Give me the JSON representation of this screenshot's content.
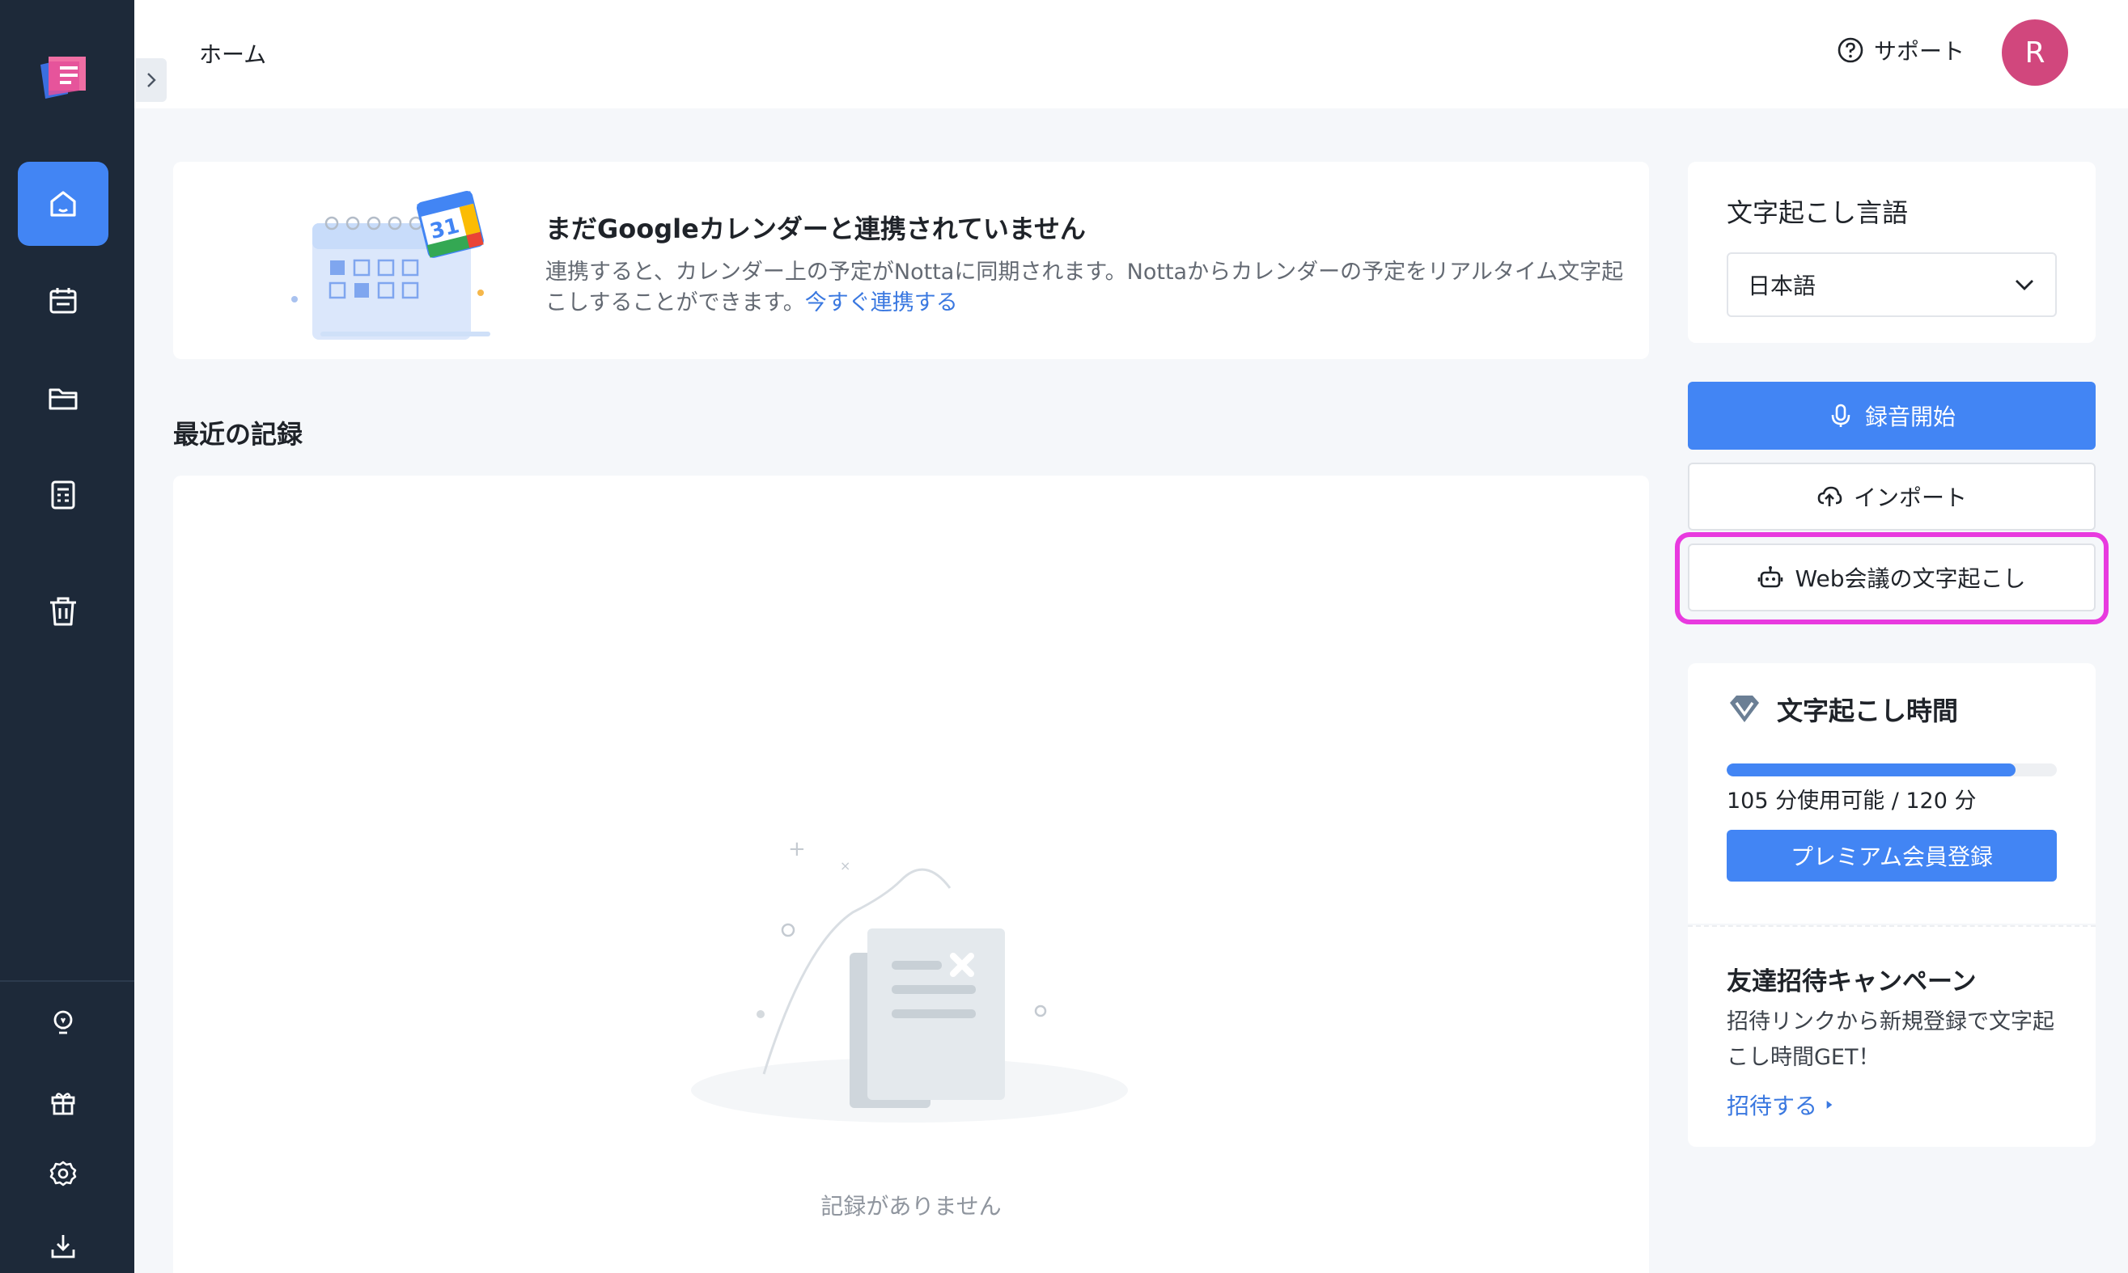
{
  "header": {
    "breadcrumb": "ホーム",
    "support_label": "サポート",
    "avatar_initial": "R"
  },
  "sidebar": {
    "items": [
      {
        "icon": "home-icon",
        "active": true
      },
      {
        "icon": "calendar-icon",
        "active": false
      },
      {
        "icon": "folder-icon",
        "active": false
      },
      {
        "icon": "document-list-icon",
        "active": false
      },
      {
        "icon": "trash-icon",
        "active": false
      }
    ],
    "bottom_items": [
      {
        "icon": "lightbulb-icon"
      },
      {
        "icon": "gift-icon"
      },
      {
        "icon": "gear-icon"
      },
      {
        "icon": "download-icon"
      }
    ]
  },
  "banner": {
    "title": "まだGoogleカレンダーと連携されていません",
    "description": "連携すると、カレンダー上の予定がNottaに同期されます。Nottaからカレンダーの予定をリアルタイム文字起こしすることができます。",
    "link_label": "今すぐ連携する",
    "calendar_day": "31"
  },
  "recent": {
    "title": "最近の記録",
    "empty_text": "記録がありません"
  },
  "language": {
    "title": "文字起こし言語",
    "selected": "日本語"
  },
  "actions": {
    "record_label": "録音開始",
    "import_label": "インポート",
    "web_meeting_label": "Web会議の文字起こし"
  },
  "transcription_time": {
    "title": "文字起こし時間",
    "usage_text": "105 分使用可能 / 120 分",
    "available_minutes": 105,
    "total_minutes": 120,
    "premium_label": "プレミアム会員登録"
  },
  "invite": {
    "title": "友達招待キャンペーン",
    "description": "招待リンクから新規登録で文字起こし時間GET！",
    "link_label": "招待する"
  },
  "colors": {
    "sidebar_bg": "#1d2939",
    "accent": "#4285f4",
    "avatar": "#d1477d",
    "highlight": "#e83adf",
    "link": "#3a78e0"
  }
}
